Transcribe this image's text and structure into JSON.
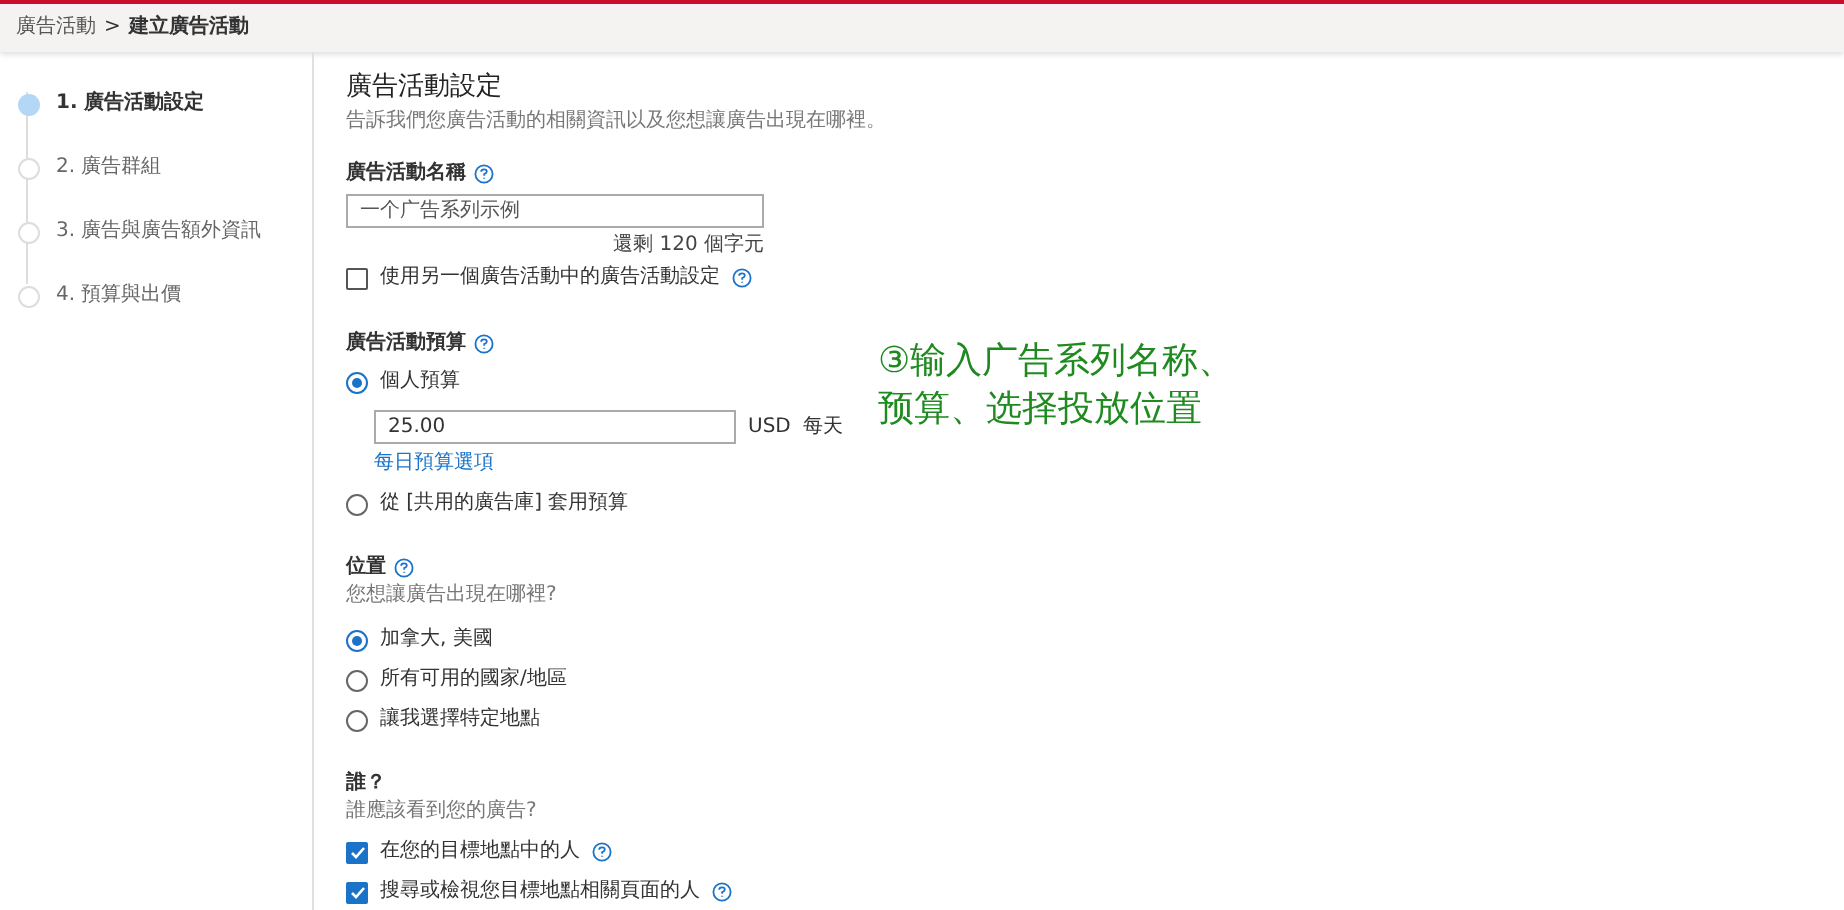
{
  "breadcrumb": {
    "parent": "廣告活動",
    "separator": ">",
    "current": "建立廣告活動"
  },
  "steps": [
    {
      "label": "1. 廣告活動設定",
      "selected": true
    },
    {
      "label": "2. 廣告群組",
      "selected": false
    },
    {
      "label": "3. 廣告與廣告額外資訊",
      "selected": false
    },
    {
      "label": "4. 預算與出價",
      "selected": false
    }
  ],
  "heading": "廣告活動設定",
  "description": "告訴我們您廣告活動的相關資訊以及您想讓廣告出現在哪裡。",
  "name_section": {
    "label": "廣告活動名稱",
    "placeholder": "一个广告系列示例",
    "remaining": "還剩 120 個字元",
    "copy_checkbox": {
      "label": "使用另一個廣告活動中的廣告活動設定",
      "checked": false
    }
  },
  "budget_section": {
    "label": "廣告活動預算",
    "options": [
      {
        "label": "個人預算",
        "selected": true,
        "amount": "25.00",
        "currency": "USD",
        "period": "每天",
        "link": "每日預算選項"
      },
      {
        "label": "從 [共用的廣告庫] 套用預算",
        "selected": false
      }
    ]
  },
  "location_section": {
    "label": "位置",
    "question": "您想讓廣告出現在哪裡?",
    "options": [
      {
        "label": "加拿大, 美國",
        "selected": true
      },
      {
        "label": "所有可用的國家/地區",
        "selected": false
      },
      {
        "label": "讓我選擇特定地點",
        "selected": false
      }
    ]
  },
  "audience_section": {
    "label": "誰？",
    "question": "誰應該看到您的廣告?",
    "options": [
      {
        "label": "在您的目標地點中的人",
        "checked": true
      },
      {
        "label": "搜尋或檢視您目標地點相關頁面的人",
        "checked": true
      }
    ]
  },
  "annotation": "③输入广告系列名称、预算、选择投放位置"
}
